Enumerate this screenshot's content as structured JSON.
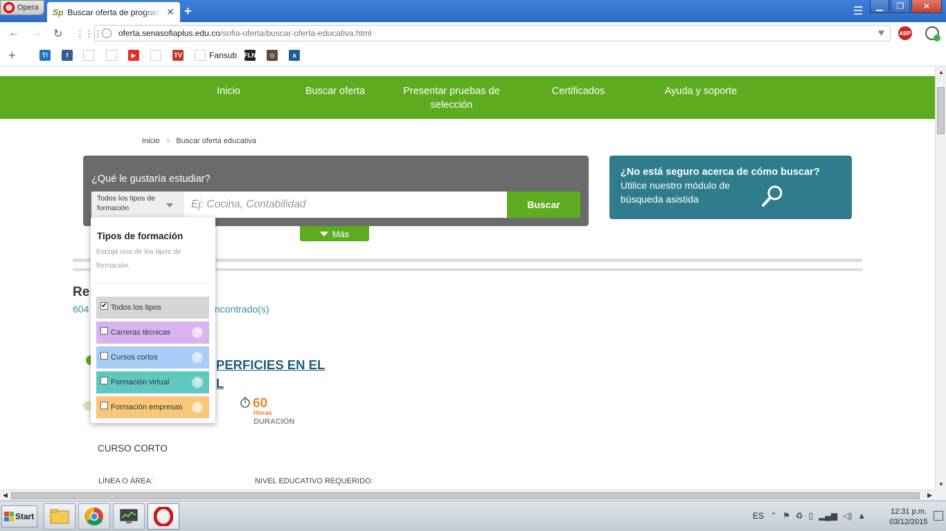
{
  "browser": {
    "menu_label": "Opera",
    "tab_title": "Buscar oferta de programas",
    "tab_favicon": "Sp",
    "url_host": "oferta.senasofiaplus.edu.co",
    "url_path": "/sofia-oferta/buscar-oferta-educativa.html",
    "abp_label": "ABP",
    "bookmarks": [
      {
        "icon": "t-icon",
        "label": "T!",
        "color": "#1a73c8"
      },
      {
        "icon": "facebook-icon",
        "label": "f",
        "color": "#3b5998"
      },
      {
        "icon": "windows-icon",
        "label": "",
        "color": "#ffffff"
      },
      {
        "icon": "twitter-icon",
        "label": "",
        "color": "#ffffff"
      },
      {
        "icon": "youtube-icon",
        "label": "▶",
        "color": "#e52d27"
      },
      {
        "icon": "document-icon",
        "label": "",
        "color": "#ffffff"
      },
      {
        "icon": "tv-icon",
        "label": "TV",
        "color": "#c0392b"
      },
      {
        "icon": "folder-icon",
        "label": "",
        "color": "#ffffff"
      },
      {
        "icon": "fln-icon",
        "label": "FLN",
        "color": "#222222"
      },
      {
        "icon": "instagram-icon",
        "label": "◎",
        "color": "#5a4a3a"
      },
      {
        "icon": "a-icon",
        "label": "a",
        "color": "#1f5f9a"
      }
    ],
    "bookmark_folder_label": "Fansub"
  },
  "site": {
    "nav": [
      "Inicio",
      "Buscar oferta",
      "Presentar pruebas de selección",
      "Certificados",
      "Ayuda y soporte"
    ],
    "breadcrumb": {
      "home": "Inicio",
      "current": "Buscar oferta educativa"
    },
    "search": {
      "question": "¿Qué le gustaría estudiar?",
      "type_select": "Todos los tipos de formación",
      "placeholder": "Ej: Cocina, Contabilidad",
      "button": "Buscar",
      "more": "Más"
    },
    "help": {
      "title": "¿No está seguro acerca de cómo buscar?",
      "text": "Utilice nuestro módulo de búsqueda asistida"
    },
    "results": {
      "title_visible": "Re",
      "count_visible": "604",
      "found_visible": "ncontrado(s)"
    },
    "course": {
      "title_line1": "PERFICIES EN EL",
      "title_line2": "L",
      "duration_value": "60",
      "duration_unit": "Horas",
      "duration_label": "DURACIÓN",
      "type": "CURSO CORTO",
      "line_label": "LÍNEA O ÁREA:",
      "level_label": "NIVEL EDUCATIVO REQUERIDO:"
    },
    "dropdown": {
      "title": "Tipos de formación",
      "subtitle": "Escoja uno de los tipos de formación.",
      "options": [
        {
          "label": "Todos los tipos",
          "checked": "✔",
          "bg": "#d6d6d6"
        },
        {
          "label": "Carreras técnicas",
          "checked": "",
          "bg": "#d9b3f0"
        },
        {
          "label": "Cursos cortos",
          "checked": "",
          "bg": "#a6cdf5"
        },
        {
          "label": "Formación virtual",
          "checked": "",
          "bg": "#5fc9c0"
        },
        {
          "label": "Formación empresas",
          "checked": "",
          "bg": "#f9c77a"
        }
      ],
      "help_glyph": "?"
    }
  },
  "taskbar": {
    "start": "Start",
    "language": "ES",
    "time": "12:31 p.m.",
    "date": "03/12/2015"
  },
  "colors": {
    "brand_green": "#5dab1f",
    "help_teal": "#2e7c8c",
    "link_blue": "#1f5f7a",
    "duration_orange": "#e8852b"
  }
}
